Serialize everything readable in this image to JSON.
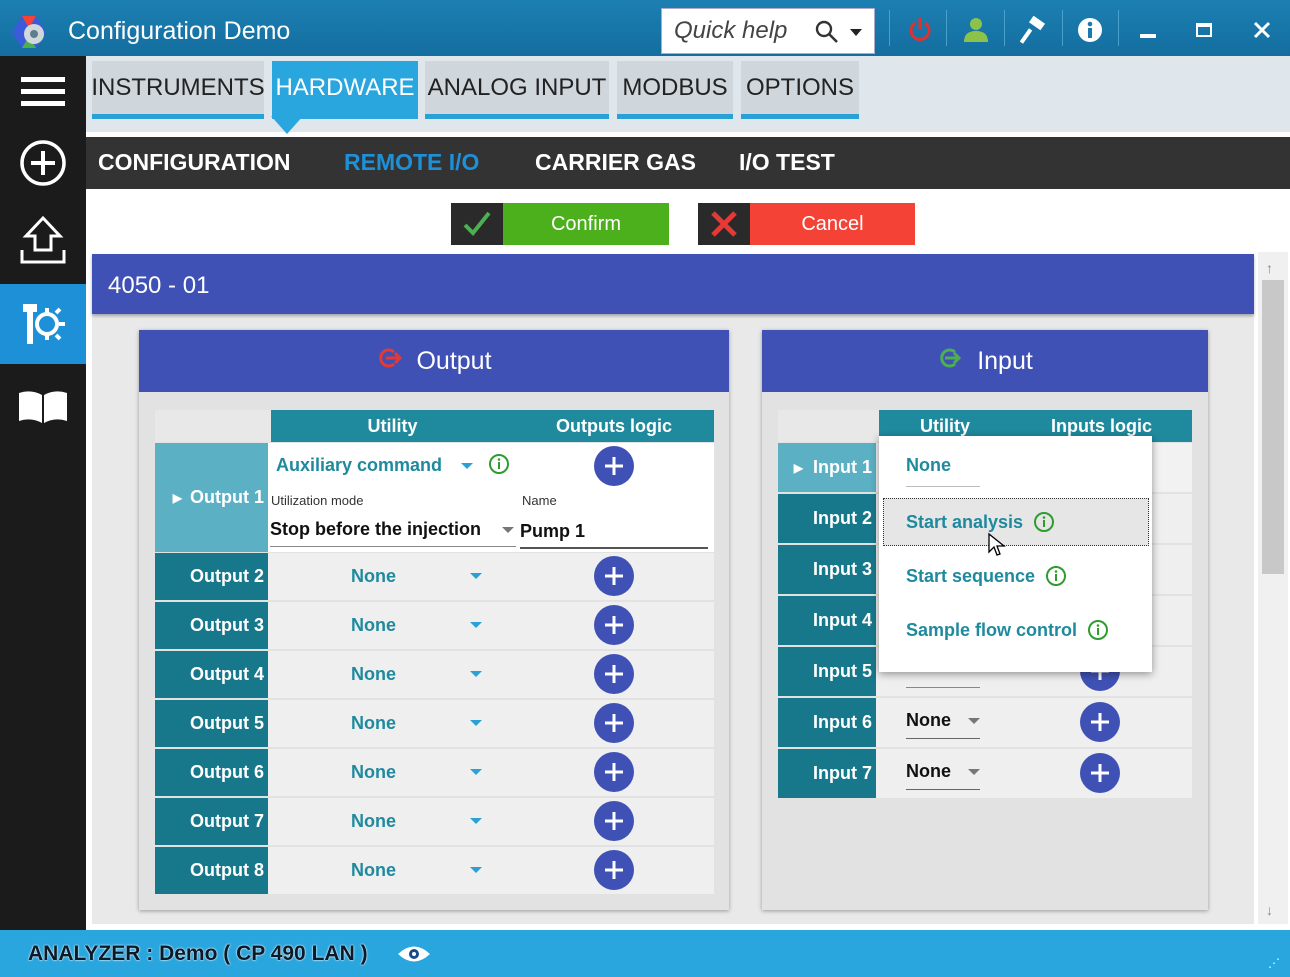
{
  "window": {
    "title": "Configuration Demo",
    "quick_help_placeholder": "Quick help",
    "colors": {
      "titlebar": "#1a7ab0",
      "accent": "#2aa6de",
      "power": "#e03030",
      "user": "#8bc34a"
    }
  },
  "tabs": [
    {
      "label": "INSTRUMENTS",
      "active": false
    },
    {
      "label": "HARDWARE",
      "active": true
    },
    {
      "label": "ANALOG INPUT",
      "active": false
    },
    {
      "label": "MODBUS",
      "active": false
    },
    {
      "label": "OPTIONS",
      "active": false
    }
  ],
  "subtabs": [
    {
      "label": "CONFIGURATION",
      "active": false
    },
    {
      "label": "REMOTE I/O",
      "active": true
    },
    {
      "label": "CARRIER GAS",
      "active": false
    },
    {
      "label": "I/O TEST",
      "active": false
    }
  ],
  "actions": {
    "confirm": "Confirm",
    "cancel": "Cancel"
  },
  "device": {
    "title": "4050 - 01"
  },
  "output": {
    "title": "Output",
    "col_utility": "Utility",
    "col_logic": "Outputs logic",
    "row1": {
      "label": "Output 1",
      "utility": "Auxiliary command",
      "mode_label": "Utilization mode",
      "mode_value": "Stop before the injection",
      "name_label": "Name",
      "name_value": "Pump 1"
    },
    "rows": [
      {
        "label": "Output 2",
        "utility": "None"
      },
      {
        "label": "Output 3",
        "utility": "None"
      },
      {
        "label": "Output 4",
        "utility": "None"
      },
      {
        "label": "Output 5",
        "utility": "None"
      },
      {
        "label": "Output 6",
        "utility": "None"
      },
      {
        "label": "Output 7",
        "utility": "None"
      },
      {
        "label": "Output 8",
        "utility": "None"
      }
    ]
  },
  "input": {
    "title": "Input",
    "col_utility": "Utility",
    "col_logic": "Inputs logic",
    "rows": [
      {
        "label": "Input 1"
      },
      {
        "label": "Input 2"
      },
      {
        "label": "Input 3"
      },
      {
        "label": "Input 4"
      },
      {
        "label": "Input 5"
      },
      {
        "label": "Input 6",
        "utility": "None"
      },
      {
        "label": "Input 7",
        "utility": "None"
      }
    ]
  },
  "dropdown": {
    "items": [
      "None",
      "Start analysis",
      "Start sequence",
      "Sample flow control"
    ],
    "hovered": "Start analysis"
  },
  "status": {
    "text": "ANALYZER : Demo ( CP 490 LAN )"
  }
}
